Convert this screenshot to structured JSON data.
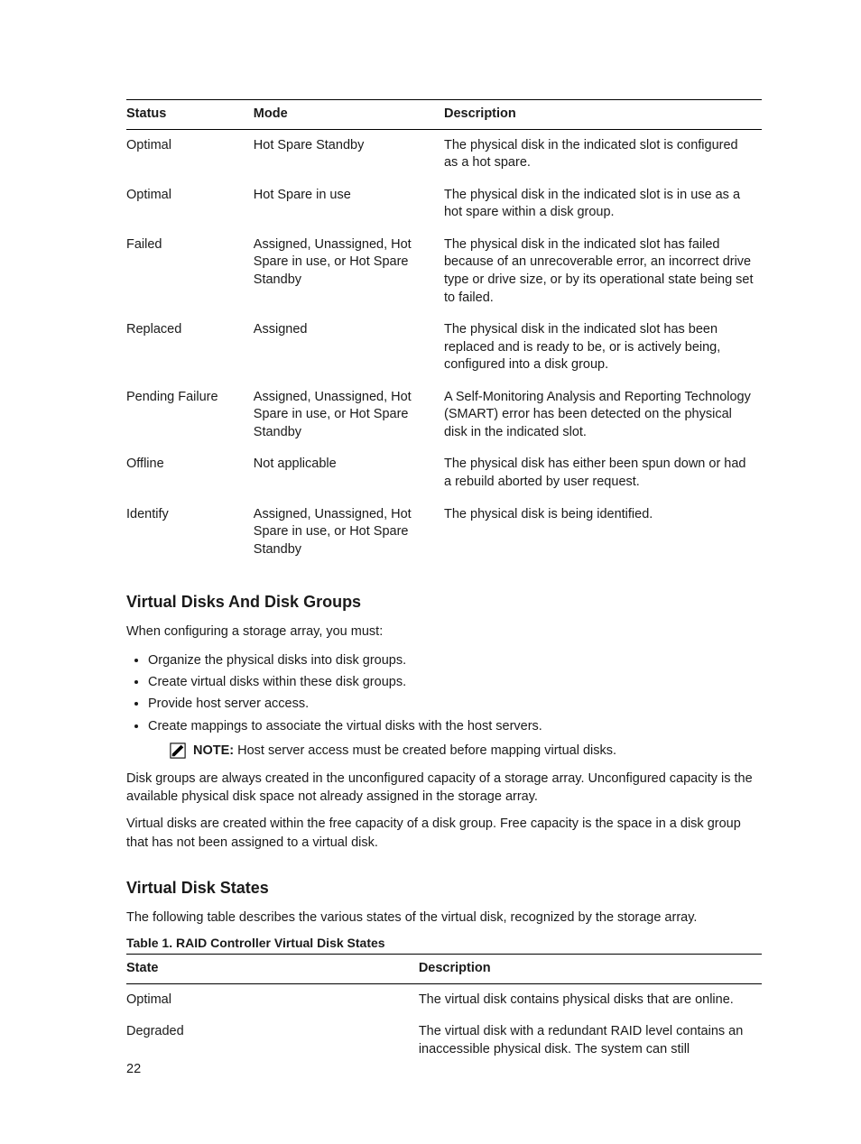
{
  "table1": {
    "headers": {
      "status": "Status",
      "mode": "Mode",
      "description": "Description"
    },
    "rows": [
      {
        "status": "Optimal",
        "mode": "Hot Spare Standby",
        "description": "The physical disk in the indicated slot is configured as a hot spare."
      },
      {
        "status": "Optimal",
        "mode": "Hot Spare in use",
        "description": "The physical disk in the indicated slot is in use as a hot spare within a disk group."
      },
      {
        "status": "Failed",
        "mode": "Assigned, Unassigned, Hot Spare in use, or Hot Spare Standby",
        "description": "The physical disk in the indicated slot has failed because of an unrecoverable error, an incorrect drive type or drive size, or by its operational state being set to failed."
      },
      {
        "status": "Replaced",
        "mode": "Assigned",
        "description": "The physical disk in the indicated slot has been replaced and is ready to be, or is actively being, configured into a disk group."
      },
      {
        "status": "Pending Failure",
        "mode": "Assigned, Unassigned, Hot Spare in use, or Hot Spare Standby",
        "description": "A Self-Monitoring Analysis and Reporting Technology (SMART) error has been detected on the physical disk in the indicated slot."
      },
      {
        "status": "Offline",
        "mode": "Not applicable",
        "description": "The physical disk has either been spun down or had a rebuild aborted by user request."
      },
      {
        "status": "Identify",
        "mode": "Assigned, Unassigned, Hot Spare in use, or Hot Spare Standby",
        "description": "The physical disk is being identified."
      }
    ]
  },
  "section_vddg": {
    "heading": "Virtual Disks And Disk Groups",
    "intro": "When configuring a storage array, you must:",
    "bullets": [
      "Organize the physical disks into disk groups.",
      "Create virtual disks within these disk groups.",
      "Provide host server access.",
      "Create mappings to associate the virtual disks with the host servers."
    ],
    "note_label": "NOTE:",
    "note_text": " Host server access must be created before mapping virtual disks.",
    "para2": "Disk groups are always created in the unconfigured capacity of a storage array. Unconfigured capacity is the available physical disk space not already assigned in the storage array.",
    "para3": "Virtual disks are created within the free capacity of a disk group. Free capacity is the space in a disk group that has not been assigned to a virtual disk."
  },
  "section_vds": {
    "heading": "Virtual Disk States",
    "intro": "The following table describes the various states of the virtual disk, recognized by the storage array.",
    "caption": "Table 1. RAID Controller Virtual Disk States",
    "headers": {
      "state": "State",
      "description": "Description"
    },
    "rows": [
      {
        "state": "Optimal",
        "description": "The virtual disk contains physical disks that are online."
      },
      {
        "state": "Degraded",
        "description": "The virtual disk with a redundant RAID level contains an inaccessible physical disk. The system can still"
      }
    ]
  },
  "page_number": "22"
}
